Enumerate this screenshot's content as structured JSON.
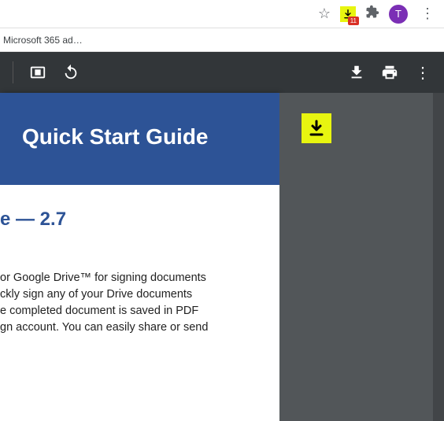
{
  "browser": {
    "extension_badge_count": "11",
    "avatar_initial": "T"
  },
  "bookmarks": {
    "item1": "Microsoft 365 ad…"
  },
  "pdf": {
    "title": "Quick Start Guide",
    "section_title": "e — 2.7",
    "body_lines": {
      "l1": "or Google Drive™ for signing documents",
      "l2": "ckly sign any of your Drive documents",
      "l3": "e completed document is saved in PDF",
      "l4": "gn account. You can easily share or send"
    }
  }
}
